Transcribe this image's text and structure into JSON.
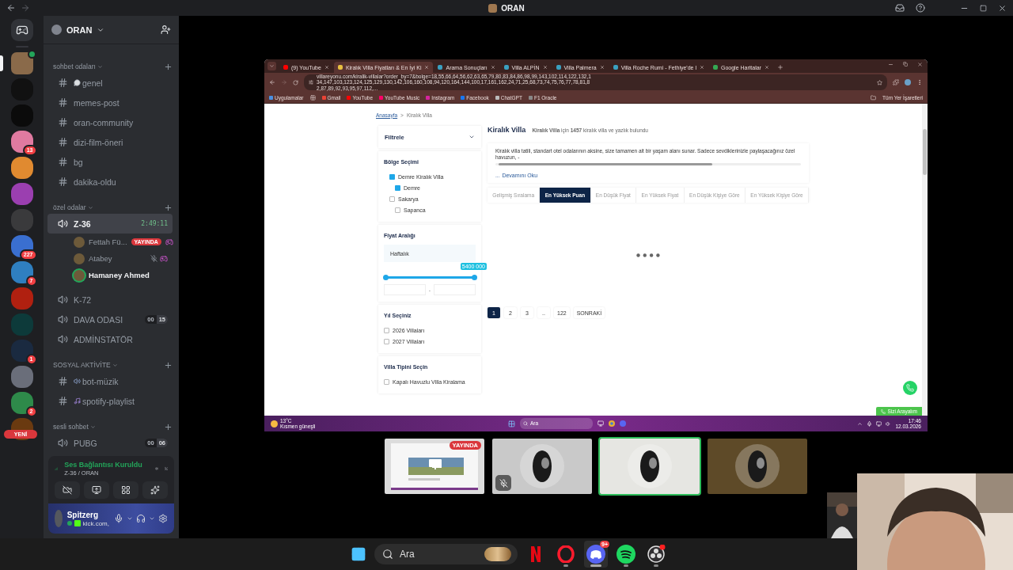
{
  "titlebar": {
    "title": "ORAN"
  },
  "servers": [
    {
      "kind": "home",
      "color": "#313338",
      "selected": false,
      "in_voice": false
    },
    {
      "kind": "server",
      "color": "#8a6a4a",
      "selected": true,
      "in_voice": true
    },
    {
      "kind": "server",
      "color": "#111111",
      "selected": false,
      "in_voice": false
    },
    {
      "kind": "server",
      "color": "#0b0b0b",
      "selected": false,
      "in_voice": false
    },
    {
      "kind": "server",
      "color": "#e07aa0",
      "selected": false,
      "in_voice": false,
      "badge": "13"
    },
    {
      "kind": "server",
      "color": "#e08a30",
      "selected": false,
      "in_voice": false
    },
    {
      "kind": "server",
      "color": "#9b3fb0",
      "selected": false,
      "in_voice": false
    },
    {
      "kind": "server",
      "color": "#3a3a3c",
      "selected": false,
      "in_voice": false
    },
    {
      "kind": "server",
      "color": "#3a6fd0",
      "selected": false,
      "in_voice": false,
      "badge": "227"
    },
    {
      "kind": "server",
      "color": "#2f7fc0",
      "selected": false,
      "in_voice": false,
      "badge": "7"
    },
    {
      "kind": "server",
      "color": "#b02010",
      "selected": false,
      "in_voice": false
    },
    {
      "kind": "server",
      "color": "#0d3a3a",
      "selected": false,
      "in_voice": false
    },
    {
      "kind": "server",
      "color": "#1a2a40",
      "selected": false,
      "in_voice": false,
      "badge": "1"
    },
    {
      "kind": "server",
      "color": "#6a6e7a",
      "selected": false,
      "in_voice": false
    },
    {
      "kind": "server",
      "color": "#2e8a4a",
      "selected": false,
      "in_voice": false,
      "badge": "2"
    },
    {
      "kind": "server",
      "color": "#6a3a10",
      "selected": false,
      "in_voice": false
    }
  ],
  "new_pill": "YENİ",
  "sidebar": {
    "server_name": "ORAN",
    "categories": [
      {
        "name": "sohbet odaları",
        "channels": [
          {
            "kind": "chat",
            "name": "genel",
            "selected": false
          },
          {
            "kind": "text",
            "name": "memes-post",
            "selected": false
          },
          {
            "kind": "text",
            "name": "oran-community",
            "selected": false
          },
          {
            "kind": "text",
            "name": "dizi-film-öneri",
            "selected": false
          },
          {
            "kind": "text",
            "name": "bg",
            "selected": false
          },
          {
            "kind": "text",
            "name": "dakika-oldu",
            "selected": false
          }
        ]
      },
      {
        "name": "özel odalar",
        "channels": [
          {
            "kind": "voice",
            "name": "Z-36",
            "selected": true,
            "timer": "2:49:11",
            "members": [
              {
                "name": "Fettah Fü...",
                "badge": "YAYINDA",
                "muted": false,
                "speaking": false,
                "activity": true
              },
              {
                "name": "Atabey",
                "muted": true,
                "speaking": false,
                "activity": true
              },
              {
                "name": "Hamaney Ahmed",
                "muted": false,
                "speaking": true,
                "activity": false
              }
            ]
          },
          {
            "kind": "voice",
            "name": "K-72",
            "selected": false
          },
          {
            "kind": "voice",
            "name": "DAVA ODASI",
            "selected": false,
            "counts": [
              "00",
              "15"
            ]
          },
          {
            "kind": "voice",
            "name": "ADMİNSTATÖR",
            "selected": false
          }
        ]
      },
      {
        "name": "SOSYAL AKTİVİTE",
        "channels": [
          {
            "kind": "audio",
            "name": "bot-müzik",
            "selected": false
          },
          {
            "kind": "music",
            "name": "spotify-playlist",
            "selected": false
          }
        ]
      },
      {
        "name": "sesli sohbet",
        "channels": [
          {
            "kind": "voice",
            "name": "PUBG",
            "selected": false,
            "counts": [
              "00",
              "06"
            ]
          }
        ]
      }
    ]
  },
  "voice_panel": {
    "status": "Ses Bağlantısı Kuruldu",
    "channel": "Z-36 / ORAN"
  },
  "user_panel": {
    "name": "Spitzerg",
    "status": "kick.com,"
  },
  "browser": {
    "tabs": [
      {
        "title": "(9) YouTube",
        "kind": "youtube",
        "selected": false
      },
      {
        "title": "Kiralık Villa Fiyatları & En İyi Ki",
        "kind": "villa",
        "selected": true
      },
      {
        "title": "Arama Sonuçları",
        "kind": "site",
        "selected": false
      },
      {
        "title": "Villa ALPİN",
        "kind": "site",
        "selected": false
      },
      {
        "title": "Villa Palmera",
        "kind": "site",
        "selected": false
      },
      {
        "title": "Villa Roche Rumi - Fethiye'de l",
        "kind": "site",
        "selected": false
      },
      {
        "title": "Google Haritalar",
        "kind": "maps",
        "selected": false
      }
    ],
    "url": "villareyonu.com/kiralik-villalar?order_by=7&bolge=18,55,66,64,56,62,63,65,79,80,83,84,86,98,99,143,102,114,122,132,134,147,103,123,124,125,129,130,142,106,160,108,94,120,164,144,100,17,161,162,24,71,25,68,73,74,75,76,77,78,81,82,87,89,92,93,95,97,112,...",
    "bookmarks": [
      {
        "label": "Uygulamalar",
        "color": "#4a90e2"
      },
      {
        "label": "Gmail",
        "color": "#ea4335"
      },
      {
        "label": "YouTube",
        "color": "#ff0000"
      },
      {
        "label": "YouTube Music",
        "color": "#ff0066"
      },
      {
        "label": "Instagram",
        "color": "#d6249f"
      },
      {
        "label": "Facebook",
        "color": "#1877f2"
      },
      {
        "label": "ChatGPT",
        "color": "#bbbbbb"
      },
      {
        "label": "F1 Oracle",
        "color": "#888888"
      }
    ],
    "all_bookmarks": "Tüm Yer İşaretleri"
  },
  "page": {
    "breadcrumb": [
      {
        "label": "Anasayfa",
        "link": true
      },
      {
        "label": "Kiralık Villa",
        "link": false
      }
    ],
    "breadcrumb_separator": ">",
    "filter": {
      "title": "Filtrele",
      "sections": [
        {
          "kind": "checklist",
          "title": "Bölge Seçimi",
          "options": [
            {
              "label": "Demre Kiralık Villa",
              "checked": true,
              "children": [
                {
                  "label": "Demre",
                  "checked": true
                }
              ]
            },
            {
              "label": "Sakarya",
              "checked": false,
              "children": [
                {
                  "label": "Sapanca",
                  "checked": false
                }
              ]
            }
          ]
        },
        {
          "kind": "price",
          "title": "Fiyat Aralığı",
          "period": "Haftalık",
          "max_label": "5400 000",
          "level": 1,
          "separator": "-"
        },
        {
          "kind": "checklist",
          "title": "Yıl Seçiniz",
          "options": [
            {
              "label": "2026 Villaları",
              "checked": false
            },
            {
              "label": "2027 Villaları",
              "checked": false
            }
          ]
        },
        {
          "kind": "checklist",
          "title": "Villa Tipini Seçin",
          "options": [
            {
              "label": "Kapalı Havuzlu Villa Kiralama",
              "checked": false
            }
          ]
        }
      ]
    },
    "heading": "Kiralık Villa",
    "summary": "**Kiralık Villa** için **1457** kiralık villa ve yazlık bulundu",
    "description": "Kiralık villa tatili, standart otel odalarının aksine, size tamamen ait bir yaşam alanı sunar. Sadece sevdiklerinizle paylaşacağınız özel havuzun, -",
    "read_more_prefix": "...",
    "read_more": "Devamını Oku",
    "sort_tabs": [
      {
        "label": "Gelişmiş Sıralama",
        "selected": false
      },
      {
        "label": "En Yüksek Puan",
        "selected": true
      },
      {
        "label": "En Düşük Fiyat",
        "selected": false
      },
      {
        "label": "En Yüksek Fiyat",
        "selected": false
      },
      {
        "label": "En Düşük Kişiye Göre",
        "selected": false
      },
      {
        "label": "En Yüksek Kişiye Göre",
        "selected": false
      }
    ],
    "pages": [
      {
        "label": "1",
        "selected": true
      },
      {
        "label": "2",
        "selected": false
      },
      {
        "label": "3",
        "selected": false
      },
      {
        "label": "..",
        "selected": false
      },
      {
        "label": "122",
        "selected": false
      },
      {
        "label": "SONRAKİ",
        "selected": false
      }
    ],
    "callback_button": "Sizi Arayalım"
  },
  "inner_taskbar": {
    "temperature": "13°C",
    "weather": "Kısmen güneşli",
    "search": "Ara",
    "time": "17:46",
    "date": "12.03.2026"
  },
  "tiles": [
    {
      "kind": "screen",
      "badge": "YAYINDA",
      "muted": false,
      "selected": false
    },
    {
      "kind": "avatar",
      "color": "#c9c9c9",
      "muted": true,
      "selected": false
    },
    {
      "kind": "avatar",
      "color": "#e6e6e2",
      "muted": false,
      "selected": true
    },
    {
      "kind": "avatar",
      "color": "#5e4a28",
      "muted": false,
      "selected": false
    }
  ],
  "taskbar": {
    "search": "Ara",
    "apps": [
      {
        "kind": "ribbon",
        "running": false,
        "active": false
      },
      {
        "kind": "ring",
        "running": true,
        "active": false
      },
      {
        "kind": "chat",
        "running": true,
        "active": true,
        "badge": "9+"
      },
      {
        "kind": "waves",
        "running": true,
        "active": false
      },
      {
        "kind": "aperture",
        "running": true,
        "active": false
      }
    ]
  }
}
